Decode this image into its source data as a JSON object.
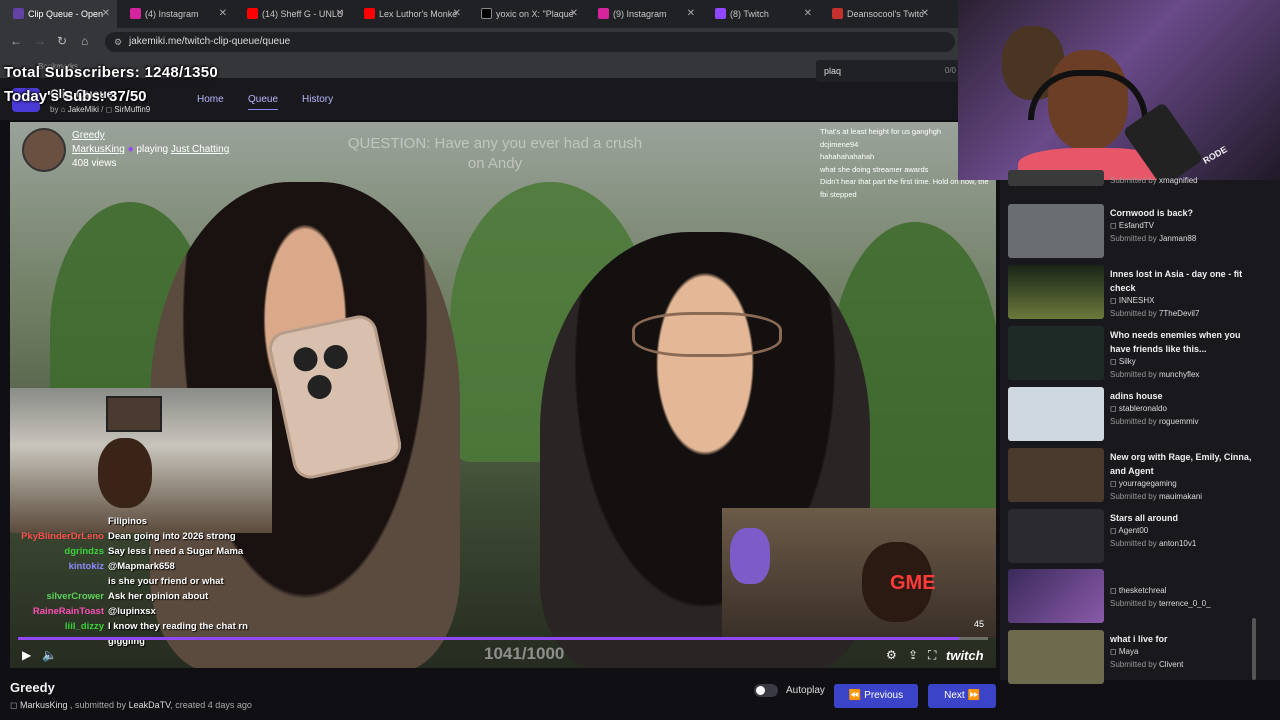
{
  "browser": {
    "tabs": [
      {
        "label": "Clip Queue - Open",
        "color": "#6441a5",
        "active": true
      },
      {
        "label": "(4) Instagram",
        "color": "#d6249f"
      },
      {
        "label": "(14) Sheff G - UNLU",
        "color": "#ff0000"
      },
      {
        "label": "Lex Luthor's Monke",
        "color": "#ff0000"
      },
      {
        "label": "yoxic on X: \"Plaque",
        "color": "#000000"
      },
      {
        "label": "(9) Instagram",
        "color": "#d6249f"
      },
      {
        "label": "(8) Twitch",
        "color": "#9147ff"
      },
      {
        "label": "Deansocool's Twitc",
        "color": "#c4302b"
      }
    ],
    "url": "jakemiki.me/twitch-clip-queue/queue",
    "bookmarks": "Bookmarks"
  },
  "overlay": {
    "total_subscribers": "Total Subscribers: 1248/1350",
    "todays_subs": "Today's Subs: 37/50",
    "search_value": "plaq",
    "search_count": "0/0"
  },
  "app": {
    "title": "Clip Queue",
    "by_label": "by",
    "author1": "JakeMiki",
    "author2": "SirMuffin9",
    "nav": {
      "home": "Home",
      "queue": "Queue",
      "history": "History"
    }
  },
  "video": {
    "title": "Greedy",
    "channel": "MarkusKing",
    "playing_label": "playing",
    "game": "Just Chatting",
    "views": "408 views",
    "question": "QUESTION: Have any you ever had a crush on Andy",
    "counter": "1041/1000",
    "time": "45",
    "progress": 0.97,
    "brand": "twitch",
    "top_chat": [
      {
        "name": "",
        "msg": "That's at least height for us ganghgh"
      },
      {
        "name": "",
        "msg": "dcjimene94"
      },
      {
        "name": "",
        "msg": "hahahahahahah"
      },
      {
        "name": "",
        "msg": "what she doing streamer awards"
      },
      {
        "name": "",
        "msg": "Didn't hear that part the first time. Hold on now, the fbi stepped"
      }
    ],
    "chat": [
      {
        "name": "",
        "msg": "Filipinos",
        "color": "#ffffff"
      },
      {
        "name": "PkyBlinderDrLeno",
        "msg": "Dean going into 2026 strong",
        "color": "#ff4d4d"
      },
      {
        "name": "dgrindzs",
        "msg": "Say less i need a Sugar Mama",
        "color": "#3cd23c"
      },
      {
        "name": "kintokiz",
        "msg": "@Mapmark658",
        "color": "#8a8aff"
      },
      {
        "name": "",
        "msg": "is she your friend or what",
        "color": "#ffffff"
      },
      {
        "name": "silverCrower",
        "msg": "Ask her opinion about",
        "color": "#5ad25a"
      },
      {
        "name": "RaineRainToast",
        "msg": "@lupinxsx",
        "color": "#ff4db8"
      },
      {
        "name": "liil_dizzy",
        "msg": "I know they reading the chat rn",
        "color": "#3cd23c"
      },
      {
        "name": "",
        "msg": "giggling",
        "color": "#ffffff"
      }
    ],
    "webcam_sign": "GME"
  },
  "streamer_cam": {
    "mic_label": "RODE"
  },
  "queue": {
    "submitted_by_label": "Submitted by",
    "items": [
      {
        "title": "",
        "channel": "",
        "submitter": "xmagnified",
        "thumb": "#3a3a3a"
      },
      {
        "title": "Cornwood is back?",
        "channel": "EsfandTV",
        "submitter": "Janman88",
        "thumb": "#6a6e72"
      },
      {
        "title": "Innes lost in Asia - day one - fit check",
        "channel": "INNESHX",
        "submitter": "7TheDevil7",
        "thumb": "#2d3a2a"
      },
      {
        "title": "Who needs enemies when you have friends like this...",
        "channel": "Silky",
        "submitter": "munchyflex",
        "thumb": "#1e2a26"
      },
      {
        "title": "adins house",
        "channel": "stableronaldo",
        "submitter": "roguemmiv",
        "thumb": "#cfd8e0"
      },
      {
        "title": "New org with Rage, Emily, Cinna, and Agent",
        "channel": "yourragegaming",
        "submitter": "mauimakani",
        "thumb": "#4a3a2e"
      },
      {
        "title": "Stars all around",
        "channel": "Agent00",
        "submitter": "anton10v1",
        "thumb": "#2a2a30"
      },
      {
        "title": "",
        "channel": "thesketchreal",
        "submitter": "terrence_0_0_",
        "thumb": "#6a4a8a"
      },
      {
        "title": "what i live for",
        "channel": "Maya",
        "submitter": "Clivent",
        "thumb": "#6e6a4e"
      }
    ]
  },
  "clip": {
    "title": "Greedy",
    "channel": "MarkusKing",
    "submitted_by": ", submitted by",
    "submitter": "LeakDaTV",
    "created": ", created 4 days ago",
    "autoplay": "Autoplay",
    "previous": "Previous",
    "next": "Next"
  }
}
